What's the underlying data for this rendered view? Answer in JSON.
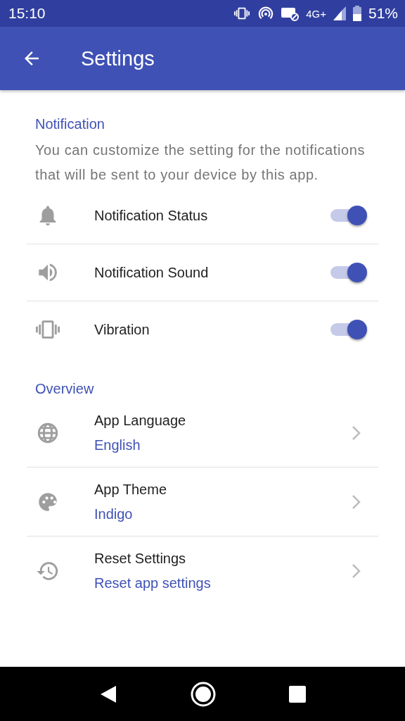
{
  "status_bar": {
    "time": "15:10",
    "network": "4G+",
    "battery": "51%"
  },
  "app_bar": {
    "title": "Settings"
  },
  "sections": [
    {
      "title": "Notification",
      "description": "You can customize the setting for the notifications that will be sent to your device by this app.",
      "items": [
        {
          "kind": "toggle",
          "label": "Notification Status",
          "on": true
        },
        {
          "kind": "toggle",
          "label": "Notification Sound",
          "on": true
        },
        {
          "kind": "toggle",
          "label": "Vibration",
          "on": true
        }
      ]
    },
    {
      "title": "Overview",
      "items": [
        {
          "kind": "link",
          "label": "App Language",
          "value": "English"
        },
        {
          "kind": "link",
          "label": "App Theme",
          "value": "Indigo"
        },
        {
          "kind": "link",
          "label": "Reset Settings",
          "value": "Reset app settings"
        }
      ]
    }
  ]
}
